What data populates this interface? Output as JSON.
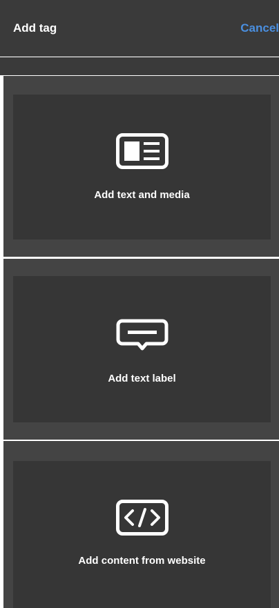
{
  "header": {
    "title": "Add tag",
    "cancel_label": "Cancel"
  },
  "options": [
    {
      "label": "Add text and media",
      "icon": "text-media-icon"
    },
    {
      "label": "Add text label",
      "icon": "text-label-icon"
    },
    {
      "label": "Add content from website",
      "icon": "code-icon"
    }
  ],
  "colors": {
    "background": "#3a3a3a",
    "panel": "#444444",
    "card": "#363636",
    "accent": "#4a8fe0",
    "text": "#ffffff"
  }
}
